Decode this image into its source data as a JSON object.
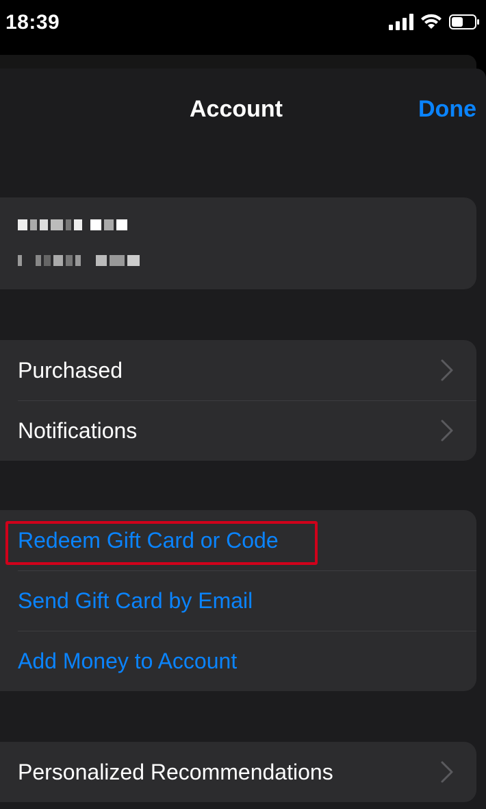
{
  "status_bar": {
    "time": "18:39",
    "icons": [
      "cellular-signal-icon",
      "wifi-icon",
      "battery-icon"
    ]
  },
  "nav": {
    "title": "Account",
    "done_label": "Done"
  },
  "profile": {
    "name": "(blurred)",
    "email": "(blurred)"
  },
  "group_purchases": {
    "items": [
      {
        "label": "Purchased"
      },
      {
        "label": "Notifications"
      }
    ]
  },
  "group_gift": {
    "items": [
      {
        "label": "Redeem Gift Card or Code"
      },
      {
        "label": "Send Gift Card by Email"
      },
      {
        "label": "Add Money to Account"
      }
    ]
  },
  "group_personalization": {
    "items": [
      {
        "label": "Personalized Recommendations"
      }
    ]
  },
  "colors": {
    "accent": "#0a84ff",
    "highlight": "#d0021b",
    "cell_background": "#2c2c2e",
    "sheet_background": "#1c1c1e"
  }
}
